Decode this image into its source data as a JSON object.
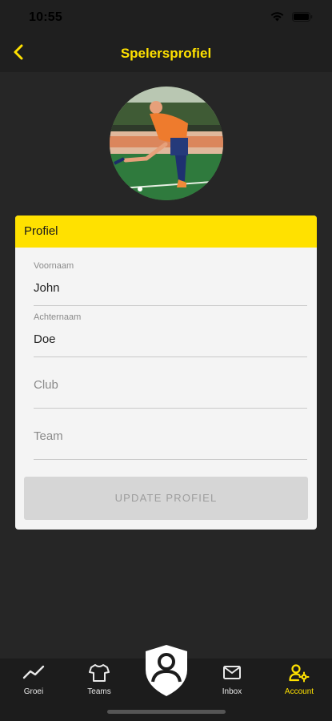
{
  "status": {
    "time": "10:55"
  },
  "header": {
    "title": "Spelersprofiel"
  },
  "card": {
    "title": "Profiel",
    "fields": [
      {
        "label": "Voornaam",
        "value": "John"
      },
      {
        "label": "Achternaam",
        "value": "Doe"
      },
      {
        "placeholder": "Club"
      },
      {
        "placeholder": "Team"
      }
    ],
    "update_label": "UPDATE PROFIEL"
  },
  "tabs": [
    {
      "label": "Groei",
      "icon": "trend-icon"
    },
    {
      "label": "Teams",
      "icon": "shirt-icon"
    },
    {
      "label": "",
      "icon": "shield-user-icon"
    },
    {
      "label": "Inbox",
      "icon": "mail-icon"
    },
    {
      "label": "Account",
      "icon": "user-gear-icon",
      "active": true
    }
  ],
  "colors": {
    "accent": "#ffe100",
    "background": "#262626",
    "bar": "#1f1f1f"
  }
}
